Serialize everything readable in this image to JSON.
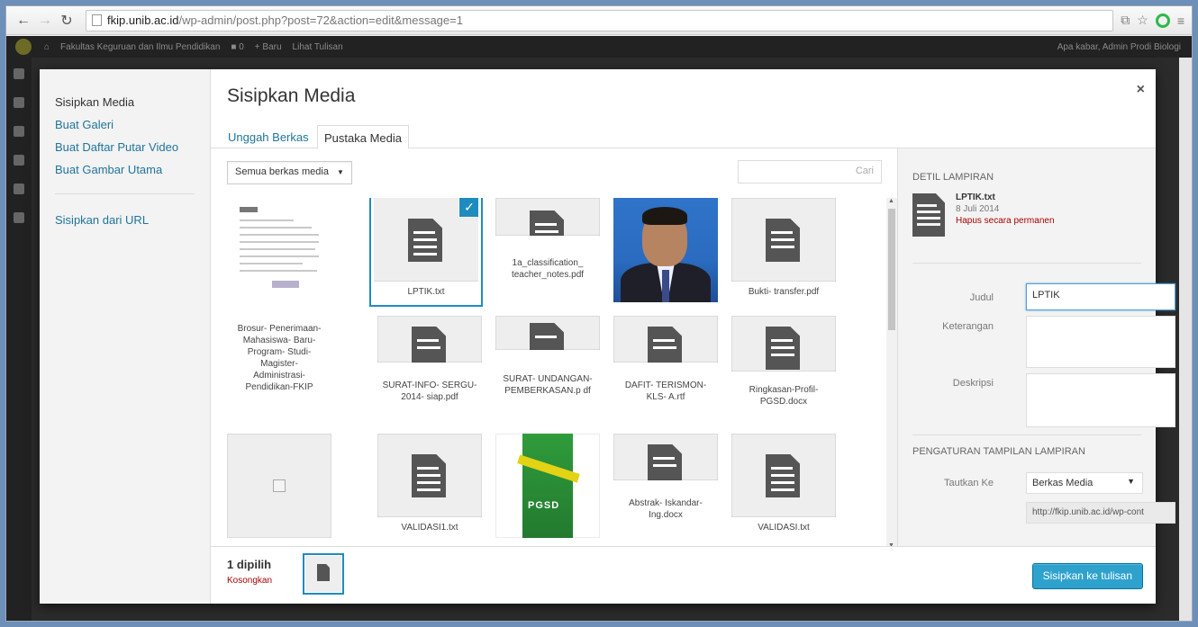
{
  "browser": {
    "url_host": "fkip.unib.ac.id",
    "url_path": "/wp-admin/post.php?post=72&action=edit&message=1",
    "icons": [
      "back-icon",
      "forward-icon",
      "reload-icon",
      "translate-icon",
      "star-icon",
      "opera-icon",
      "menu-icon"
    ]
  },
  "wp_adminbar": {
    "site_name": "Fakultas Keguruan dan Ilmu Pendidikan",
    "comments_count": "0",
    "new_label": "Baru",
    "view_post": "Lihat Tulisan",
    "greeting": "Apa kabar, Admin Prodi Biologi"
  },
  "modal": {
    "title": "Sisipkan Media",
    "close": "×",
    "menu": [
      {
        "label": "Sisipkan Media"
      },
      {
        "label": "Buat Galeri"
      },
      {
        "label": "Buat Daftar Putar Video"
      },
      {
        "label": "Buat Gambar Utama"
      },
      {
        "label": "Sisipkan dari URL"
      }
    ],
    "tabs": [
      {
        "label": "Unggah Berkas"
      },
      {
        "label": "Pustaka Media"
      }
    ],
    "filter": {
      "value": "Semua berkas media",
      "arrow": "▼"
    },
    "search": {
      "placeholder": "Cari"
    },
    "attachments": [
      {
        "type": "document-scan",
        "label": ""
      },
      {
        "type": "file",
        "label": "LPTIK.txt",
        "selected": true
      },
      {
        "type": "file",
        "label": "1a_classification_ teacher_notes.pdf"
      },
      {
        "type": "photo",
        "label": ""
      },
      {
        "type": "file",
        "label": "Bukti- transfer.pdf"
      },
      {
        "type": "text",
        "label": "Brosur- Penerimaan- Mahasiswa- Baru-Program- Studi-Magister- Administrasi- Pendidikan-FKIP"
      },
      {
        "type": "file",
        "label": "SURAT-INFO- SERGU-2014- siap.pdf"
      },
      {
        "type": "file",
        "label": "SURAT- UNDANGAN- PEMBERKASAN.p df"
      },
      {
        "type": "file",
        "label": "DAFIT- TERISMON-KLS- A.rtf"
      },
      {
        "type": "file",
        "label": "Ringkasan-Profil- PGSD.docx"
      },
      {
        "type": "broken-image",
        "label": ""
      },
      {
        "type": "file",
        "label": "VALIDASI1.txt"
      },
      {
        "type": "pgsd-cover",
        "label": "PGSD"
      },
      {
        "type": "file",
        "label": "Abstrak- Iskandar- Ing.docx"
      },
      {
        "type": "file",
        "label": "VALIDASI.txt"
      }
    ],
    "check_mark": "✓",
    "details": {
      "heading": "Detil Lampiran",
      "filename": "LPTIK.txt",
      "date": "8 Juli 2014",
      "delete": "Hapus secara permanen",
      "title_label": "Judul",
      "title_value": "LPTIK",
      "caption_label": "Keterangan",
      "caption_value": "",
      "description_label": "Deskripsi",
      "description_value": "",
      "display_heading": "Pengaturan Tampilan Lampiran",
      "link_to_label": "Tautkan Ke",
      "link_to_value": "Berkas Media",
      "link_url": "http://fkip.unib.ac.id/wp-cont"
    },
    "footer": {
      "selected_count": "1 dipilih",
      "clear": "Kosongkan",
      "insert_button": "Sisipkan ke tulisan"
    }
  },
  "colors": {
    "accent": "#2ea2cc",
    "link": "#21759b",
    "selection": "#1e8cbe",
    "danger": "#aa0000"
  }
}
